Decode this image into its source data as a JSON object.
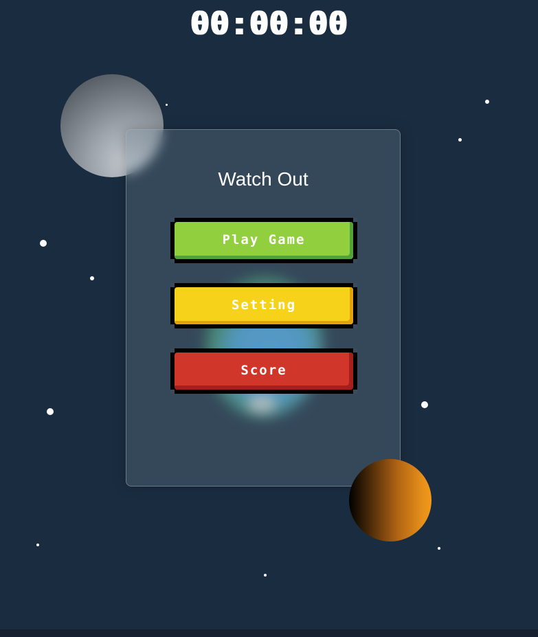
{
  "hud": {
    "timer": "00:00:00"
  },
  "menu": {
    "title": "Watch Out",
    "buttons": {
      "play": "Play Game",
      "setting": "Setting",
      "score": "Score"
    }
  },
  "colors": {
    "background": "#1a2d40",
    "play_button": "#92cf3f",
    "setting_button": "#f7d21a",
    "score_button": "#d0362a",
    "text": "#ffffff"
  },
  "decorations": {
    "planets": [
      "moon",
      "earth",
      "sun"
    ]
  }
}
